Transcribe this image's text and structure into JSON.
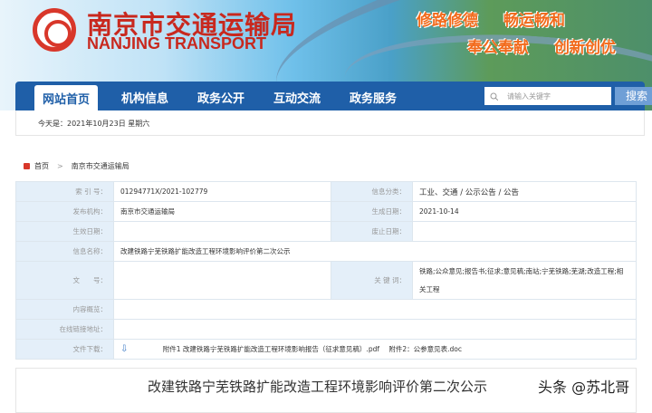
{
  "header": {
    "title_cn": "南京市交通运输局",
    "title_en": "NANJING TRANSPORT",
    "slogans": [
      "修路修德",
      "畅运畅和",
      "奉公奉献",
      "创新创优"
    ]
  },
  "nav": {
    "items": [
      "网站首页",
      "机构信息",
      "政务公开",
      "互动交流",
      "政务服务"
    ],
    "search_placeholder": "请输入关键字",
    "search_label": "搜索"
  },
  "date_text": "今天是：2021年10月23日 星期六",
  "breadcrumb": [
    "首页",
    ">",
    "南京市交通运输局"
  ],
  "info": {
    "index_label": "索 引 号：",
    "index": "01294771X/2021-102779",
    "category_label": "信息分类：",
    "category": "工业、交通 / 公示公告 / 公告",
    "publisher_label": "发布机构：",
    "publisher": "南京市交通运输局",
    "created_label": "生成日期：",
    "created": "2021-10-14",
    "effective_label": "生效日期：",
    "effective": "",
    "expire_label": "废止日期：",
    "expire": "",
    "name_label": "信息名称：",
    "name": "改建铁路宁芜铁路扩能改造工程环境影响评价第二次公示",
    "doc_label": "文　　号：",
    "doc": "",
    "keywords_label": "关 键 词：",
    "keywords": "铁路;公众意见;报告书;征求;意见稿;南站;宁芜铁路;芜湖;改造工程;相关工程",
    "summary_label": "内容概览：",
    "link_label": "在线链接地址：",
    "download_label": "文件下载：",
    "attachment1": "附件1 改建铁路宁芜铁路扩能改造工程环境影响报告（征求意见稿）.pdf",
    "attachment2": "附件2：公参意见表.doc"
  },
  "article_title": "改建铁路宁芜铁路扩能改造工程环境影响评价第二次公示",
  "watermark": "头条 @苏北哥"
}
